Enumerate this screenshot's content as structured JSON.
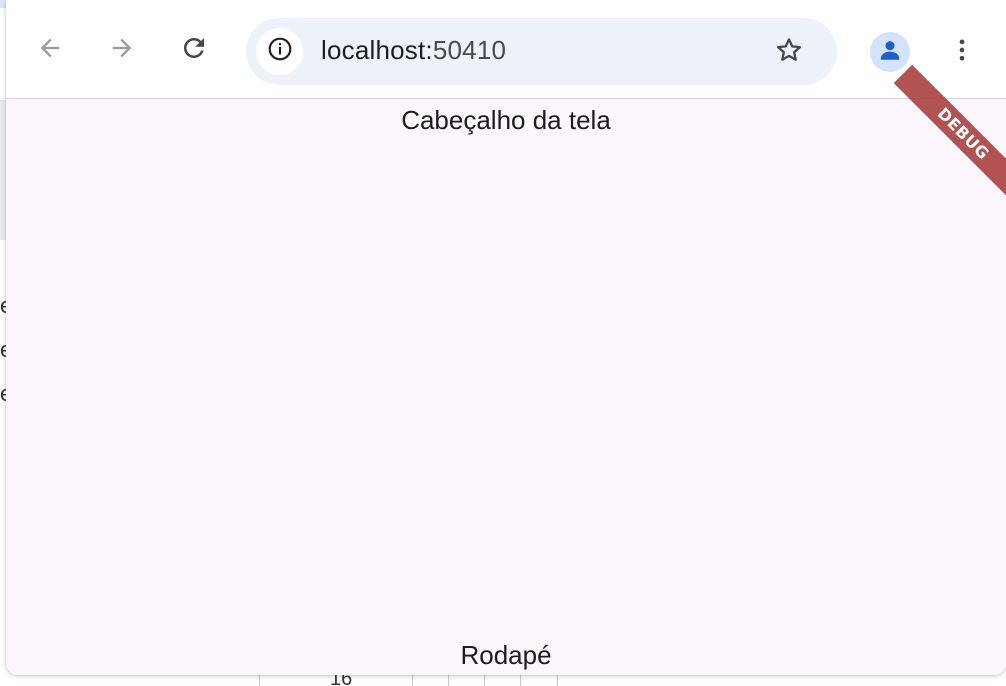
{
  "browser": {
    "url_host": "localhost:",
    "url_port": "50410",
    "icons": {
      "back": "arrow-left-icon",
      "forward": "arrow-right-icon",
      "reload": "reload-icon",
      "site_info": "info-icon",
      "bookmark": "star-icon",
      "profile": "person-icon",
      "menu": "more-vert-icon"
    },
    "colors": {
      "omnibox_bg": "#edf2fa",
      "avatar_bg": "#d3e3fd",
      "avatar_fg": "#1f5ec8",
      "disabled_icon": "#9a9a9a",
      "active_icon": "#444746"
    }
  },
  "app": {
    "header": "Cabeçalho da tela",
    "footer": "Rodapé",
    "debug_banner": "DEBUG",
    "colors": {
      "background": "#fcf7fd",
      "text": "#1d1b20",
      "banner": "#a02828"
    }
  },
  "background_window": {
    "partial_text": "16"
  }
}
